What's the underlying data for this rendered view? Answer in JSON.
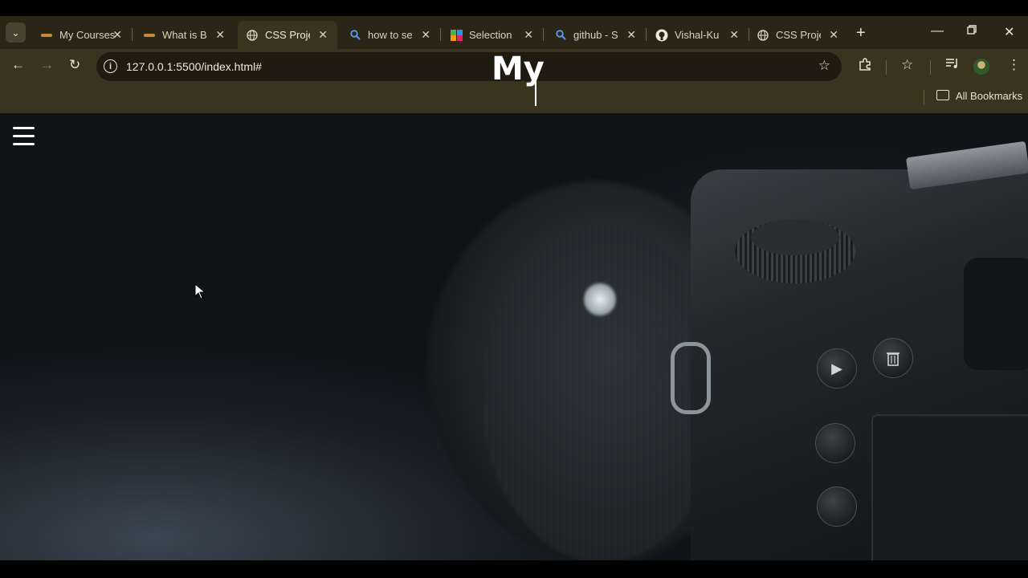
{
  "browser": {
    "tabs": [
      {
        "title": "My Courses",
        "favicon": "site-favicon",
        "active": false
      },
      {
        "title": "What is Bootstrap",
        "favicon": "site-favicon",
        "active": false
      },
      {
        "title": "CSS Project",
        "favicon": "globe-icon",
        "active": true
      },
      {
        "title": "how to set",
        "favicon": "search-icon",
        "active": false
      },
      {
        "title": "Selection",
        "favicon": "multicolor-icon",
        "active": false
      },
      {
        "title": "github - Search",
        "favicon": "search-icon",
        "active": false
      },
      {
        "title": "Vishal-Kumar",
        "favicon": "github-icon",
        "active": false
      },
      {
        "title": "CSS Project",
        "favicon": "globe-icon",
        "active": false
      }
    ],
    "address_bar": {
      "url": "127.0.0.1:5500/index.html#"
    },
    "bookmarks": {
      "all_bookmarks_label": "All Bookmarks"
    }
  },
  "page": {
    "typed_heading": "My"
  },
  "colors": {
    "chrome_frame": "#3a3320",
    "tabstrip": "#2a2516",
    "omnibox": "#1f1b10",
    "hero_text": "#ffffff"
  }
}
